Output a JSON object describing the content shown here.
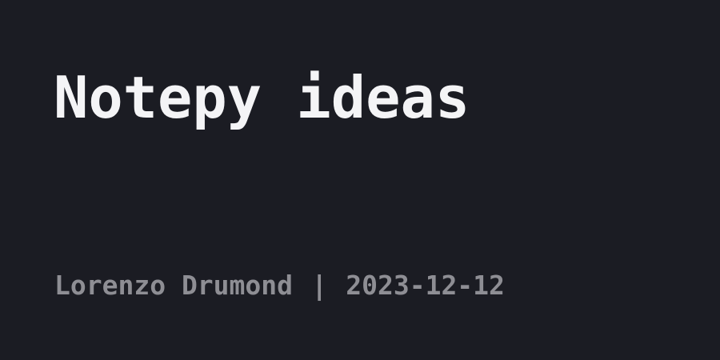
{
  "title": "Notepy ideas",
  "author": "Lorenzo Drumond",
  "separator": "|",
  "date": "2023-12-12",
  "colors": {
    "background": "#1b1c23",
    "title": "#f4f4f6",
    "meta": "#8e8e94"
  }
}
